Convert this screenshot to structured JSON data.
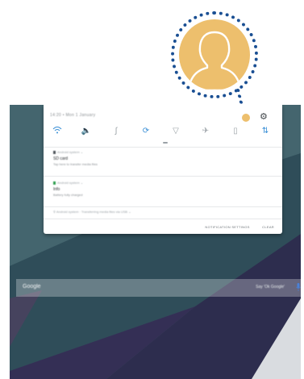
{
  "colors": {
    "callout_border": "#1a4f93",
    "avatar_fill": "#edbf6d",
    "accent_blue": "#3a8fd6",
    "wallpaper_base": "#3c5a63"
  },
  "status_bar": {
    "time_date": "14:20 • Mon 1 January",
    "avatar_icon": "user-avatar-icon",
    "settings_icon": "gear-icon"
  },
  "quick_settings": [
    {
      "icon": "wifi-icon",
      "active": true
    },
    {
      "icon": "sound-icon",
      "active": true
    },
    {
      "icon": "bluetooth-icon",
      "active": false
    },
    {
      "icon": "auto-rotate-icon",
      "active": true
    },
    {
      "icon": "flashlight-icon",
      "active": false
    },
    {
      "icon": "airplane-mode-icon",
      "active": false
    },
    {
      "icon": "power-saving-icon",
      "active": false
    },
    {
      "icon": "mobile-data-icon",
      "active": true
    }
  ],
  "notifications": [
    {
      "app": "Android system",
      "title": "SD card",
      "text": "Tap here to transfer media files"
    },
    {
      "app": "Android system",
      "title": "Info",
      "text": "Battery fully charged"
    }
  ],
  "notification_collapsed": "Android system · Transferring media files via USB",
  "panel_actions": {
    "notification_settings": "NOTIFICATION SETTINGS",
    "clear": "CLEAR"
  },
  "google_bar": {
    "logo": "Google",
    "hint": "Say 'Ok Google'",
    "mic_icon": "microphone-icon"
  }
}
